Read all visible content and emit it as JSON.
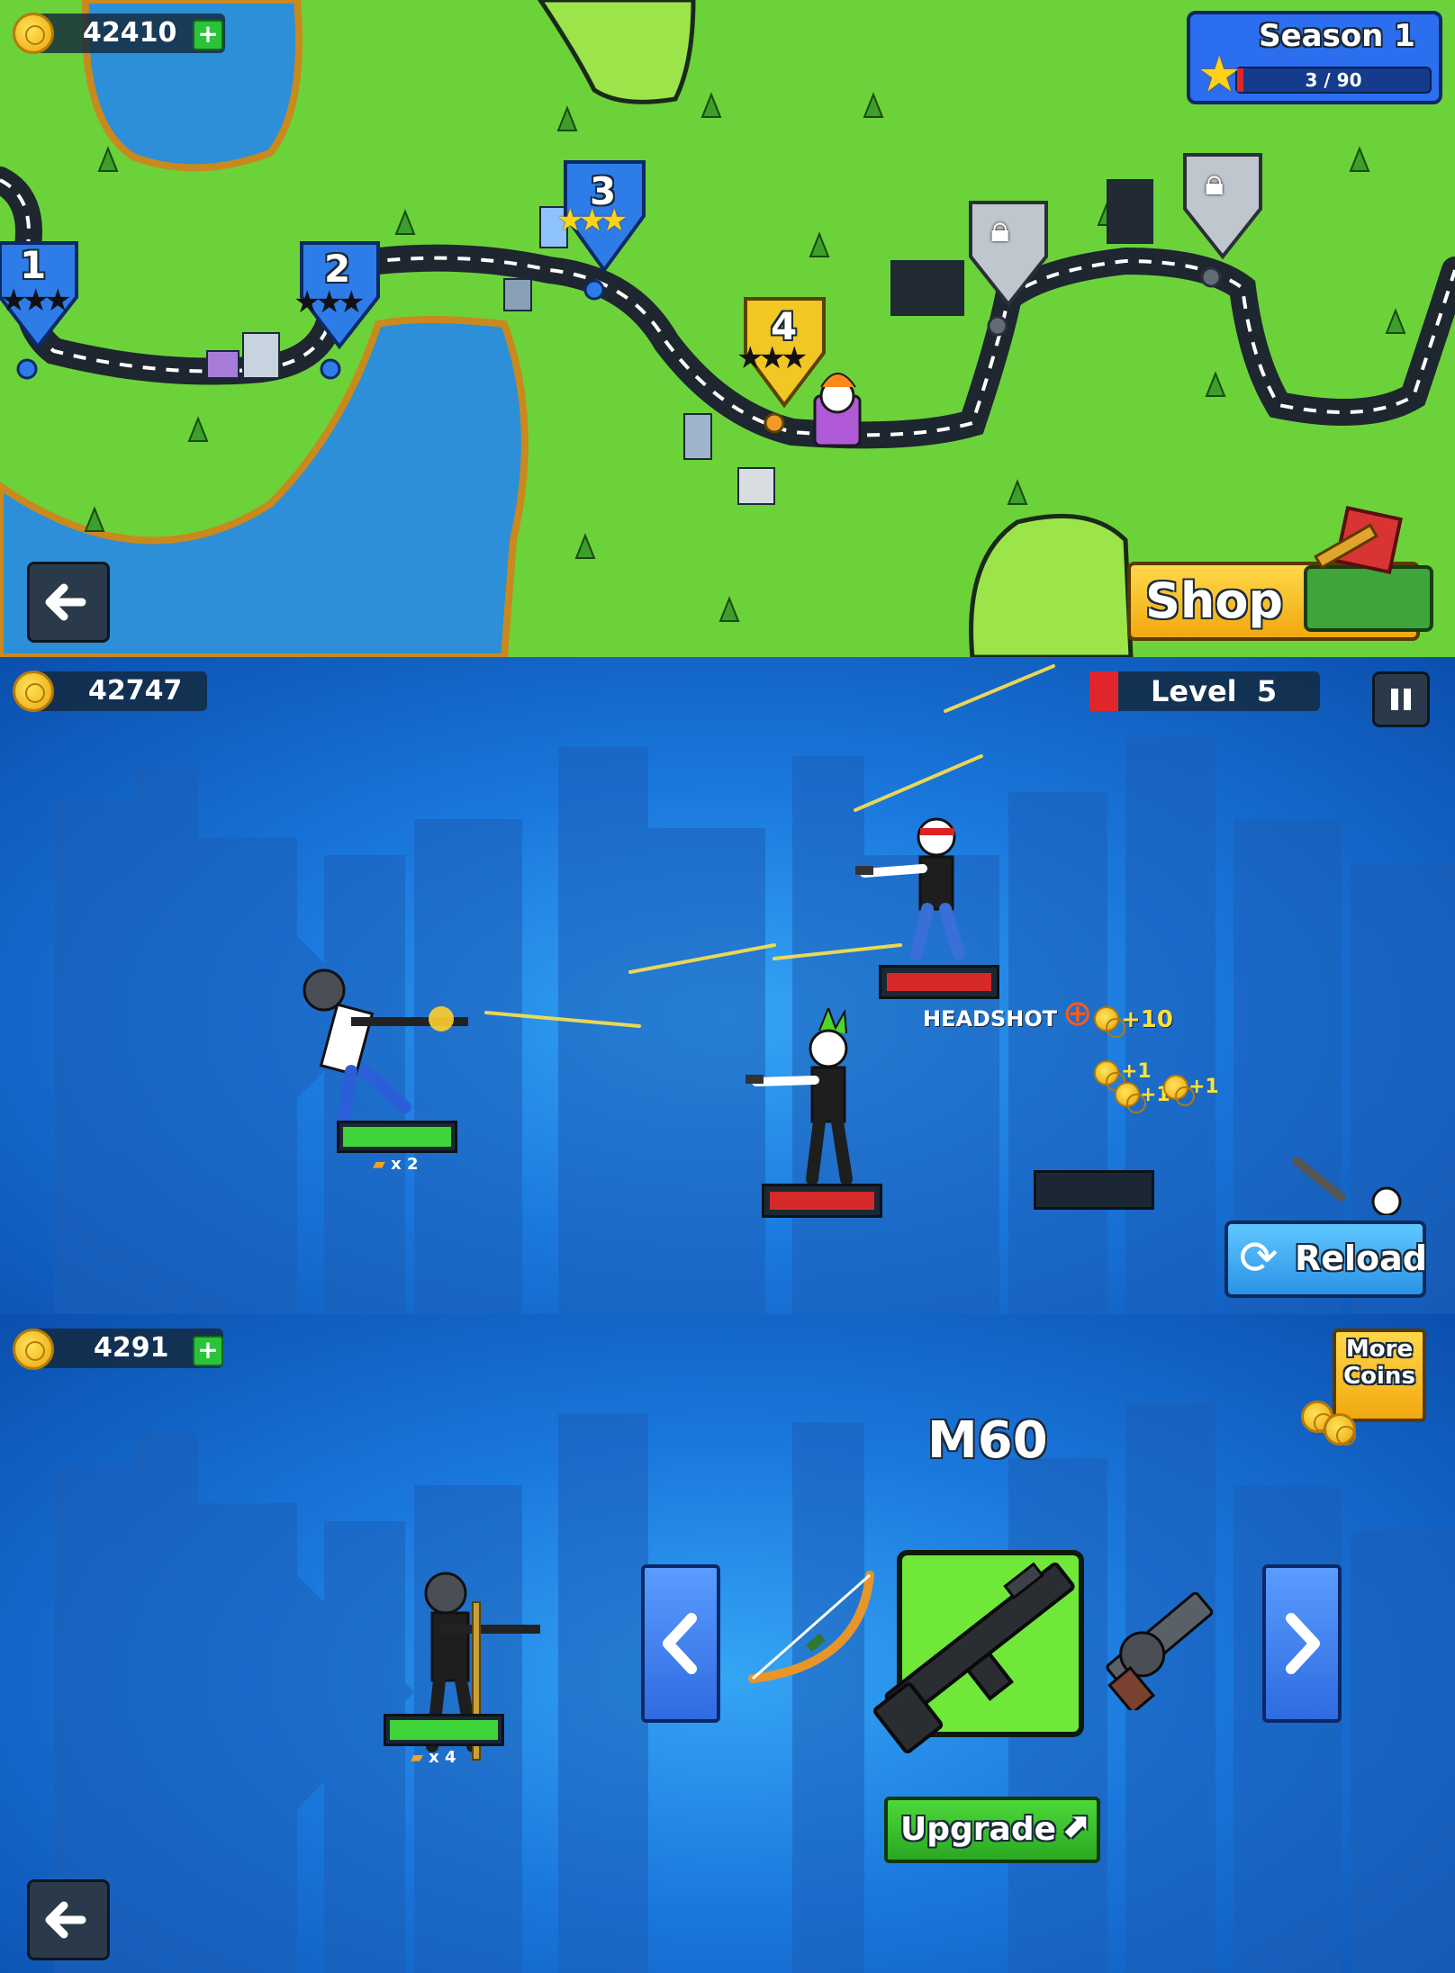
{
  "map": {
    "coins": "42410",
    "season": {
      "title": "Season 1",
      "progress_text": "3 / 90",
      "progress_fraction": 0.033
    },
    "levels": [
      {
        "number": "1",
        "state": "completed",
        "stars": 0
      },
      {
        "number": "2",
        "state": "completed",
        "stars": 0
      },
      {
        "number": "3",
        "state": "completed",
        "stars": 3
      },
      {
        "number": "4",
        "state": "current",
        "stars": 0
      },
      {
        "number": "",
        "state": "locked"
      },
      {
        "number": "",
        "state": "locked"
      }
    ],
    "shop_label": "Shop",
    "back_icon": "back-arrow-icon"
  },
  "battle": {
    "coins": "42747",
    "level_text": "Level  5",
    "headshot_text": "HEADSHOT",
    "headshot_reward": "+10",
    "coin_pickups": [
      "+1",
      "+1",
      "+1"
    ],
    "ammo_text": "x 2",
    "reload_label": "Reload",
    "player_health": 1.0,
    "enemy_health": [
      1.0,
      1.0
    ],
    "colors": {
      "player_bar": "#3fd43a",
      "enemy_bar": "#d62a2a",
      "level_flag": "#e0262a"
    }
  },
  "armory": {
    "coins": "4291",
    "more_coins_label": [
      "More",
      "Coins"
    ],
    "weapon_name": "M60",
    "ammo_text": "x 4",
    "upgrade_label": "Upgrade",
    "weapons_visible": [
      "bow-icon",
      "m60-icon",
      "grenade-launcher-icon"
    ],
    "colors": {
      "selected_slot": "#6fe83a",
      "upgrade_button": "#35c22a"
    }
  }
}
